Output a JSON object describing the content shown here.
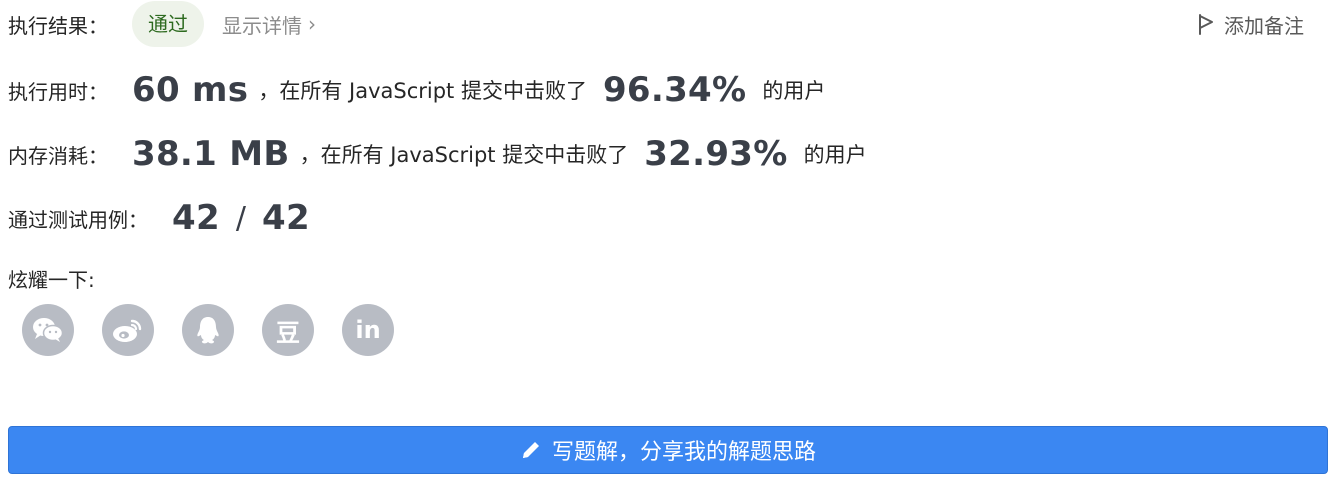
{
  "result": {
    "label": "执行结果：",
    "status": "通过",
    "details_link": "显示详情",
    "add_note": "添加备注"
  },
  "runtime": {
    "label": "执行用时：",
    "value": "60 ms",
    "mid_text": "，在所有 JavaScript 提交中击败了",
    "percent": "96.34%",
    "suffix": "的用户"
  },
  "memory": {
    "label": "内存消耗：",
    "value": "38.1 MB",
    "mid_text": "，在所有 JavaScript 提交中击败了",
    "percent": "32.93%",
    "suffix": "的用户"
  },
  "tests": {
    "label": "通过测试用例：",
    "passed": "42",
    "separator": "/",
    "total": "42"
  },
  "share": {
    "label": "炫耀一下:",
    "icons": [
      "wechat-icon",
      "weibo-icon",
      "qq-icon",
      "douban-icon",
      "linkedin-icon"
    ],
    "douban_glyph": "豆",
    "linkedin_glyph": "in"
  },
  "write_solution": {
    "label": "写题解，分享我的解题思路"
  },
  "colors": {
    "accent_blue": "#3b87f2",
    "success_bg": "#eef3ea",
    "share_icon_bg": "#b8bcc4"
  }
}
